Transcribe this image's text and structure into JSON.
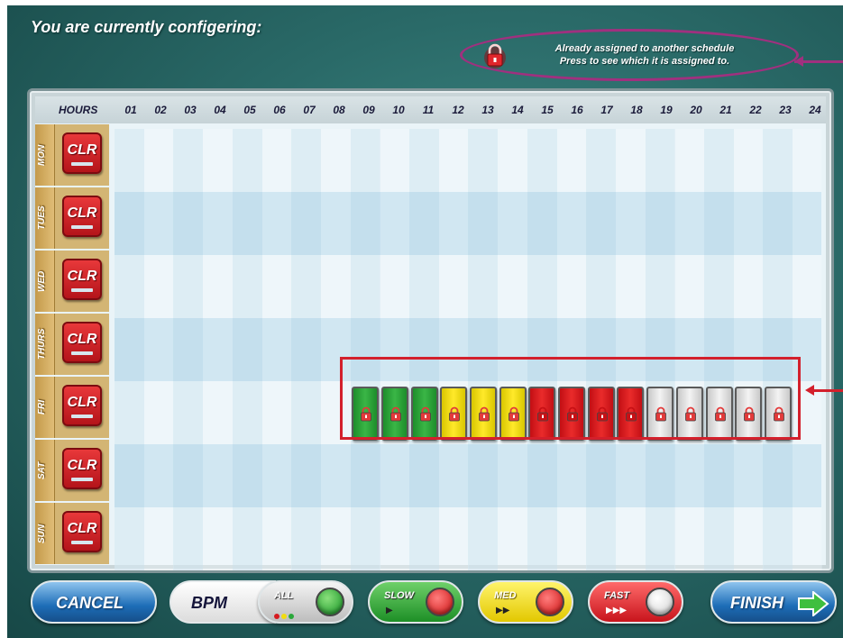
{
  "header": {
    "title": "You are currently configering:"
  },
  "legend": {
    "line1": "Already assigned to another schedule",
    "line2": "Press to see which it is assigned to."
  },
  "grid": {
    "hours_label": "HOURS",
    "hours": [
      "01",
      "02",
      "03",
      "04",
      "05",
      "06",
      "07",
      "08",
      "09",
      "10",
      "11",
      "12",
      "13",
      "14",
      "15",
      "16",
      "17",
      "18",
      "19",
      "20",
      "21",
      "22",
      "23",
      "24"
    ],
    "days": [
      {
        "name": "MON",
        "clr": "CLR"
      },
      {
        "name": "TUES",
        "clr": "CLR"
      },
      {
        "name": "WED",
        "clr": "CLR"
      },
      {
        "name": "THURS",
        "clr": "CLR"
      },
      {
        "name": "FRI",
        "clr": "CLR"
      },
      {
        "name": "SAT",
        "clr": "CLR"
      },
      {
        "name": "SUN",
        "clr": "CLR"
      }
    ],
    "assigned_slots": [
      {
        "day": "FRI",
        "hour": "09",
        "speed": "slow"
      },
      {
        "day": "FRI",
        "hour": "10",
        "speed": "slow"
      },
      {
        "day": "FRI",
        "hour": "11",
        "speed": "slow"
      },
      {
        "day": "FRI",
        "hour": "12",
        "speed": "med"
      },
      {
        "day": "FRI",
        "hour": "13",
        "speed": "med"
      },
      {
        "day": "FRI",
        "hour": "14",
        "speed": "med"
      },
      {
        "day": "FRI",
        "hour": "15",
        "speed": "fast"
      },
      {
        "day": "FRI",
        "hour": "16",
        "speed": "fast"
      },
      {
        "day": "FRI",
        "hour": "17",
        "speed": "fast"
      },
      {
        "day": "FRI",
        "hour": "18",
        "speed": "fast"
      },
      {
        "day": "FRI",
        "hour": "19",
        "speed": "all"
      },
      {
        "day": "FRI",
        "hour": "20",
        "speed": "all"
      },
      {
        "day": "FRI",
        "hour": "21",
        "speed": "all"
      },
      {
        "day": "FRI",
        "hour": "22",
        "speed": "all"
      },
      {
        "day": "FRI",
        "hour": "23",
        "speed": "all"
      }
    ]
  },
  "toolbar": {
    "cancel": "CANCEL",
    "bpm": "BPM",
    "all": "ALL",
    "slow": "SLOW",
    "med": "MED",
    "fast": "FAST",
    "finish": "FINISH"
  },
  "colors": {
    "slow": "#2aa83a",
    "med": "#f2dc10",
    "fast": "#d61a1f",
    "all": "#e6e6e6",
    "legend_outline": "#a0307f",
    "highlight_outline": "#d3202c"
  },
  "icons": {
    "lock": "lock-icon",
    "arrow": "arrow-right-icon"
  }
}
